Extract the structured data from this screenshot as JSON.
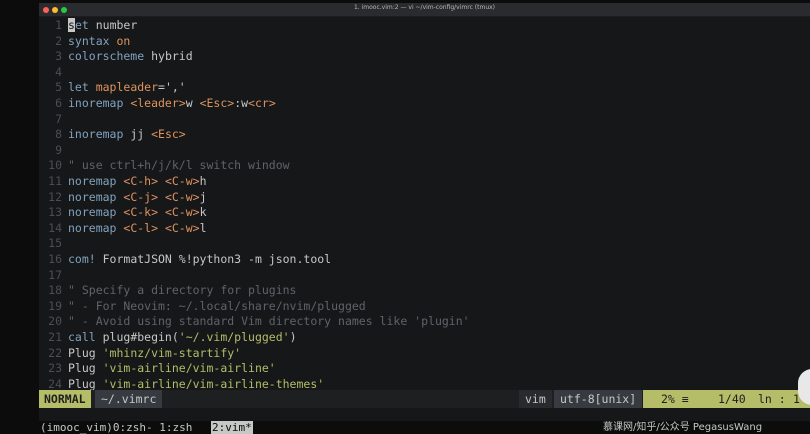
{
  "window": {
    "title": "1. imooc.vim:2 — vi ~/vim-config/vimrc (tmux)"
  },
  "editor": {
    "lines": [
      {
        "n": "1",
        "parts": [
          {
            "t": "s",
            "c": "cursor"
          },
          {
            "t": "et ",
            "c": "kw"
          },
          {
            "t": "number",
            "c": "pl"
          }
        ]
      },
      {
        "n": "2",
        "parts": [
          {
            "t": "syntax ",
            "c": "kw"
          },
          {
            "t": "on",
            "c": "val"
          }
        ]
      },
      {
        "n": "3",
        "parts": [
          {
            "t": "colorscheme ",
            "c": "kw"
          },
          {
            "t": "hybrid",
            "c": "pl"
          }
        ]
      },
      {
        "n": "4",
        "parts": []
      },
      {
        "n": "5",
        "parts": [
          {
            "t": "let ",
            "c": "kw"
          },
          {
            "t": "mapleader",
            "c": "val"
          },
          {
            "t": "=','",
            "c": "pl"
          }
        ]
      },
      {
        "n": "6",
        "parts": [
          {
            "t": "inoremap ",
            "c": "kw"
          },
          {
            "t": "<leader>",
            "c": "sym"
          },
          {
            "t": "w ",
            "c": "pl"
          },
          {
            "t": "<Esc>",
            "c": "sym"
          },
          {
            "t": ":w",
            "c": "pl"
          },
          {
            "t": "<cr>",
            "c": "sym"
          }
        ]
      },
      {
        "n": "7",
        "parts": []
      },
      {
        "n": "8",
        "parts": [
          {
            "t": "inoremap ",
            "c": "kw"
          },
          {
            "t": "jj ",
            "c": "pl"
          },
          {
            "t": "<Esc>",
            "c": "sym"
          }
        ]
      },
      {
        "n": "9",
        "parts": []
      },
      {
        "n": "10",
        "parts": [
          {
            "t": "\" use ctrl+h/j/k/l switch window",
            "c": "cmt"
          }
        ]
      },
      {
        "n": "11",
        "parts": [
          {
            "t": "noremap ",
            "c": "kw"
          },
          {
            "t": "<C-h>",
            "c": "sym"
          },
          {
            "t": " ",
            "c": "pl"
          },
          {
            "t": "<C-w>",
            "c": "sym"
          },
          {
            "t": "h",
            "c": "pl"
          }
        ]
      },
      {
        "n": "12",
        "parts": [
          {
            "t": "noremap ",
            "c": "kw"
          },
          {
            "t": "<C-j>",
            "c": "sym"
          },
          {
            "t": " ",
            "c": "pl"
          },
          {
            "t": "<C-w>",
            "c": "sym"
          },
          {
            "t": "j",
            "c": "pl"
          }
        ]
      },
      {
        "n": "13",
        "parts": [
          {
            "t": "noremap ",
            "c": "kw"
          },
          {
            "t": "<C-k>",
            "c": "sym"
          },
          {
            "t": " ",
            "c": "pl"
          },
          {
            "t": "<C-w>",
            "c": "sym"
          },
          {
            "t": "k",
            "c": "pl"
          }
        ]
      },
      {
        "n": "14",
        "parts": [
          {
            "t": "noremap ",
            "c": "kw"
          },
          {
            "t": "<C-l>",
            "c": "sym"
          },
          {
            "t": " ",
            "c": "pl"
          },
          {
            "t": "<C-w>",
            "c": "sym"
          },
          {
            "t": "l",
            "c": "pl"
          }
        ]
      },
      {
        "n": "15",
        "parts": []
      },
      {
        "n": "16",
        "parts": [
          {
            "t": "com! ",
            "c": "kw"
          },
          {
            "t": "FormatJSON %!python3 -m json.tool",
            "c": "pl"
          }
        ]
      },
      {
        "n": "17",
        "parts": []
      },
      {
        "n": "18",
        "parts": [
          {
            "t": "\" Specify a directory for plugins",
            "c": "cmt"
          }
        ]
      },
      {
        "n": "19",
        "parts": [
          {
            "t": "\" - For Neovim: ~/.local/share/nvim/plugged",
            "c": "cmt"
          }
        ]
      },
      {
        "n": "20",
        "parts": [
          {
            "t": "\" - Avoid using standard Vim directory names like 'plugin'",
            "c": "cmt"
          }
        ]
      },
      {
        "n": "21",
        "parts": [
          {
            "t": "call ",
            "c": "kw"
          },
          {
            "t": "plug#begin(",
            "c": "pl"
          },
          {
            "t": "'~/.vim/plugged'",
            "c": "str"
          },
          {
            "t": ")",
            "c": "pl"
          }
        ]
      },
      {
        "n": "22",
        "parts": [
          {
            "t": "Plug ",
            "c": "pl"
          },
          {
            "t": "'mhinz/vim-startify'",
            "c": "str"
          }
        ]
      },
      {
        "n": "23",
        "parts": [
          {
            "t": "Plug ",
            "c": "pl"
          },
          {
            "t": "'vim-airline/vim-airline'",
            "c": "str"
          }
        ]
      },
      {
        "n": "24",
        "parts": [
          {
            "t": "Plug ",
            "c": "pl"
          },
          {
            "t": "'vim-airline/vim-airline-themes'",
            "c": "str"
          }
        ]
      }
    ]
  },
  "statusline": {
    "mode": "NORMAL",
    "filename": "~/.vimrc",
    "filetype": "vim",
    "encoding": "utf-8[unix]",
    "percent": "2% ≡",
    "line": "1/40",
    "col_label": "ln :",
    "col": "1"
  },
  "tmux": {
    "left": "(imooc_vim)0:zsh- 1:zsh ",
    "active": "2:vim*",
    "right": "慕课网/知乎/公众号 PegasusWang"
  },
  "colors": {
    "keyword": "#81a2be",
    "string": "#b5bd68",
    "special": "#de935f",
    "comment": "#5f6369",
    "mode_bg": "#b5bd68"
  }
}
